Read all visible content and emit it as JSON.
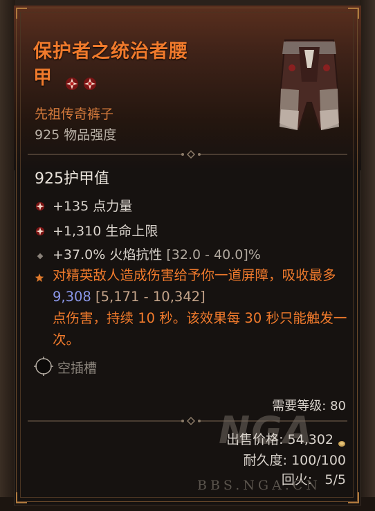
{
  "item": {
    "name": "保护者之统治者腰甲",
    "name_line1": "保护者之统治者腰",
    "name_line2": "甲",
    "type": "先祖传奇裤子",
    "item_power": "925 物品强度",
    "armor": "925护甲值"
  },
  "affixes": [
    {
      "text": "+135 点力量",
      "bullet": "greater-affix-icon"
    },
    {
      "text": "+1,310 生命上限",
      "bullet": "greater-affix-icon"
    },
    {
      "text": "+37.0% 火焰抗性",
      "range": "[32.0 - 40.0]%",
      "bullet": "diamond-bullet-icon"
    }
  ],
  "legendary": {
    "part1": "对精英敌人造成伤害给予你一道屏障，吸收最多",
    "value": "9,308",
    "range": "[5,171 - 10,342]",
    "part2": "点伤害，持续 10 秒。该效果每 30 秒只能触发一次。"
  },
  "socket": {
    "label": "空插槽"
  },
  "requirements": {
    "level_text": "需要等级: 80"
  },
  "footer": {
    "sell_label": "出售价格:",
    "sell_value": "54,302",
    "durability_label": "耐久度:",
    "durability_value": "100/100",
    "tempers_label": "回火:",
    "tempers_value": "5/5"
  },
  "watermark": {
    "logo": "NGA",
    "url": "BBS.NGA.CN"
  },
  "colors": {
    "legendary_orange": "#f07a2c",
    "ancestral_text": "#d47a3c",
    "value_blue": "#8a96e8",
    "text_light": "#d9d3cc"
  }
}
